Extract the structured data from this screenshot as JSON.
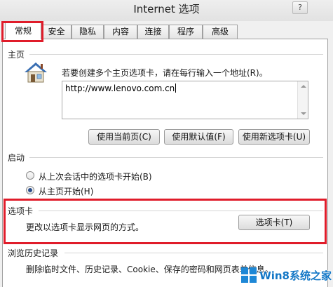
{
  "window": {
    "title": "Internet 选项",
    "help_label": "?"
  },
  "tabs": [
    {
      "label": "常规",
      "active": true
    },
    {
      "label": "安全"
    },
    {
      "label": "隐私"
    },
    {
      "label": "内容"
    },
    {
      "label": "连接"
    },
    {
      "label": "程序"
    },
    {
      "label": "高级"
    }
  ],
  "home_page": {
    "group_title": "主页",
    "description": "若要创建多个主页选项卡，请在每行输入一个地址(R)。",
    "url_value": "http://www.lenovo.com.cn",
    "buttons": {
      "use_current": "使用当前页(C)",
      "use_default": "使用默认值(F)",
      "use_new_tab": "使用新选项卡(U)"
    }
  },
  "startup": {
    "group_title": "启动",
    "options": [
      {
        "label": "从上次会话中的选项卡开始(B)",
        "selected": false
      },
      {
        "label": "从主页开始(H)",
        "selected": true
      }
    ]
  },
  "tabs_section": {
    "group_title": "选项卡",
    "description": "更改以选项卡显示网页的方式。",
    "button_label": "选项卡(T)"
  },
  "history": {
    "group_title": "浏览历史记录",
    "description": "删除临时文件、历史记录、Cookie、保存的密码和网页表单信息。"
  },
  "watermark": {
    "text": "Win8系统之家"
  },
  "colors": {
    "highlight": "#e01c2a",
    "radio_dot": "#2b4f8c",
    "watermark": "#1377c6"
  }
}
